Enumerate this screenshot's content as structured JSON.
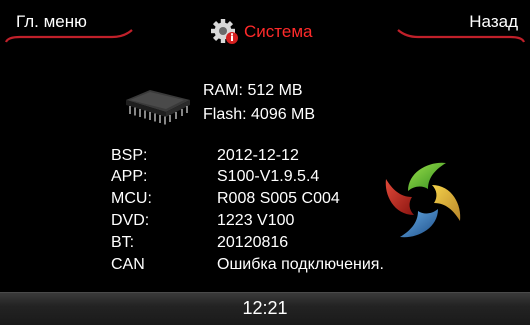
{
  "header": {
    "home_label": "Гл. меню",
    "back_label": "Назад",
    "title": "Система",
    "title_icon": "gear-info-icon"
  },
  "memory": {
    "icon": "memory-chip-icon",
    "ram": "RAM:  512 MB",
    "flash": "Flash: 4096 MB"
  },
  "versions": [
    {
      "label": "BSP:",
      "value": "2012-12-12"
    },
    {
      "label": "APP:",
      "value": "S100-V1.9.5.4"
    },
    {
      "label": "MCU:",
      "value": "R008 S005 C004"
    },
    {
      "label": "DVD:",
      "value": "1223 V100"
    },
    {
      "label": "BT:",
      "value": "20120816"
    },
    {
      "label": "CAN",
      "value": "Ошибка подключения."
    }
  ],
  "logo": {
    "icon": "brand-swirl-logo"
  },
  "footer": {
    "clock": "12:21"
  },
  "colors": {
    "background": "#000000",
    "title": "#ff2a2a",
    "accent_line": "#c0202a",
    "text": "#ffffff"
  }
}
